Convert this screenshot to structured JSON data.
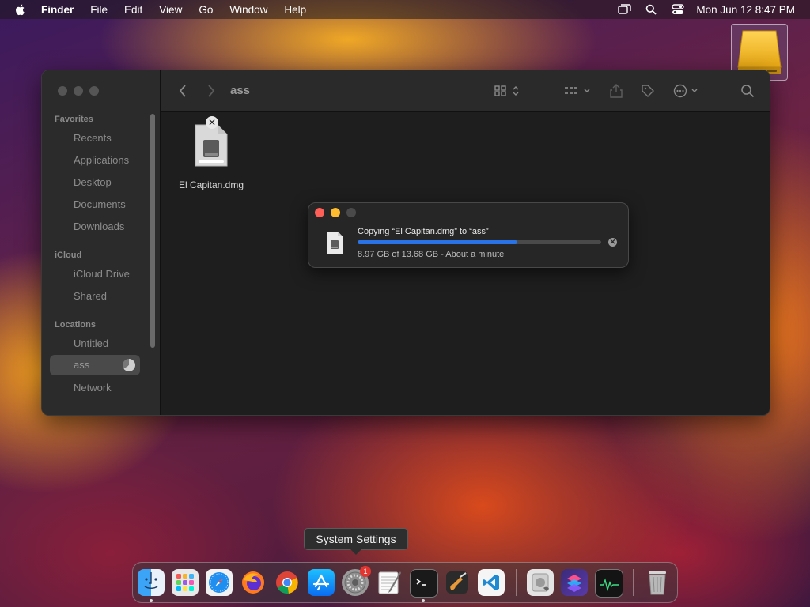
{
  "menubar": {
    "app_name": "Finder",
    "items": [
      "File",
      "Edit",
      "View",
      "Go",
      "Window",
      "Help"
    ],
    "clock": "Mon Jun 12  8:47 PM"
  },
  "finder": {
    "location_title": "ass",
    "sidebar": {
      "favorites_header": "Favorites",
      "favorites": [
        "Recents",
        "Applications",
        "Desktop",
        "Documents",
        "Downloads"
      ],
      "icloud_header": "iCloud",
      "icloud": [
        "iCloud Drive",
        "Shared"
      ],
      "locations_header": "Locations",
      "locations": [
        "Untitled",
        "ass",
        "Network"
      ]
    },
    "file": {
      "name": "El Capitan.dmg"
    }
  },
  "copy_dialog": {
    "title": "Copying “El Capitan.dmg” to “ass”",
    "status": "8.97 GB of 13.68 GB - About a minute",
    "progress": 0.656
  },
  "tooltip": {
    "text": "System Settings"
  },
  "dock": {
    "apps": [
      "Finder",
      "Launchpad",
      "Safari",
      "Firefox",
      "Chrome",
      "App Store",
      "System Settings",
      "TextEdit",
      "Terminal",
      "GarageBand",
      "Visual Studio Code",
      "Disk Utility",
      "Shortcuts",
      "Activity Monitor",
      "Trash"
    ],
    "settings_badge": "1"
  },
  "colors": {
    "accent": "#2a73e6",
    "close": "#ff5f57",
    "minimize": "#febc2e"
  }
}
